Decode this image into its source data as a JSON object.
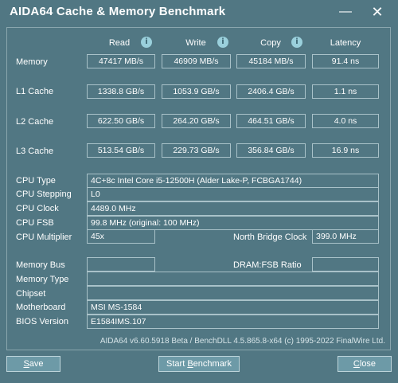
{
  "window": {
    "title": "AIDA64 Cache & Memory Benchmark",
    "minimize_glyph": "—",
    "close_glyph": "✕"
  },
  "columns": {
    "read": "Read",
    "write": "Write",
    "copy": "Copy",
    "latency": "Latency",
    "info_glyph": "i"
  },
  "rows": [
    {
      "label": "Memory",
      "read": "47417 MB/s",
      "write": "46909 MB/s",
      "copy": "45184 MB/s",
      "latency": "91.4 ns"
    },
    {
      "label": "L1 Cache",
      "read": "1338.8 GB/s",
      "write": "1053.9 GB/s",
      "copy": "2406.4 GB/s",
      "latency": "1.1 ns"
    },
    {
      "label": "L2 Cache",
      "read": "622.50 GB/s",
      "write": "264.20 GB/s",
      "copy": "464.51 GB/s",
      "latency": "4.0 ns"
    },
    {
      "label": "L3 Cache",
      "read": "513.54 GB/s",
      "write": "229.73 GB/s",
      "copy": "356.84 GB/s",
      "latency": "16.9 ns"
    }
  ],
  "cpu": {
    "type_label": "CPU Type",
    "type_value": "4C+8c Intel Core i5-12500H  (Alder Lake-P, FCBGA1744)",
    "stepping_label": "CPU Stepping",
    "stepping_value": "L0",
    "clock_label": "CPU Clock",
    "clock_value": "4489.0 MHz",
    "fsb_label": "CPU FSB",
    "fsb_value": "99.8 MHz  (original: 100 MHz)",
    "multiplier_label": "CPU Multiplier",
    "multiplier_value": "45x",
    "nb_clock_label": "North Bridge Clock",
    "nb_clock_value": "399.0 MHz"
  },
  "memory": {
    "bus_label": "Memory Bus",
    "bus_value": "",
    "ratio_label": "DRAM:FSB Ratio",
    "ratio_value": "",
    "type_label": "Memory Type",
    "type_value": "",
    "chipset_label": "Chipset",
    "chipset_value": "",
    "motherboard_label": "Motherboard",
    "motherboard_value": "MSI MS-1584",
    "bios_label": "BIOS Version",
    "bios_value": "E1584IMS.107"
  },
  "footer": "AIDA64 v6.60.5918 Beta / BenchDLL 4.5.865.8-x64  (c) 1995-2022 FinalWire Ltd.",
  "buttons": {
    "save_hotkey": "S",
    "save_rest": "ave",
    "start_label": "Start ",
    "start_hotkey": "B",
    "start_rest": "enchmark",
    "close_hotkey": "C",
    "close_rest": "lose"
  }
}
